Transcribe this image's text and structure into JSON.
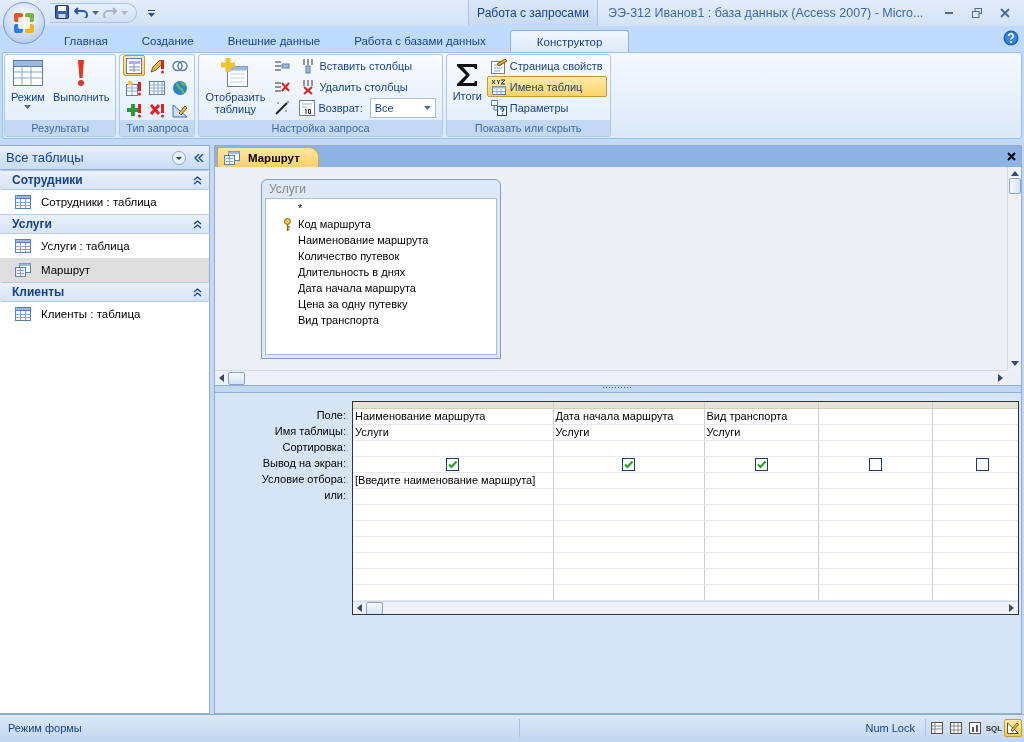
{
  "title_bar": {
    "contextual_tab": "Работа с запросами",
    "title": "ЭЭ-312 Иванов1 : база данных (Access 2007) - Micro..."
  },
  "ribbon_tabs": [
    {
      "label": "Главная",
      "selected": false
    },
    {
      "label": "Создание",
      "selected": false
    },
    {
      "label": "Внешние данные",
      "selected": false
    },
    {
      "label": "Работа с базами данных",
      "selected": false
    },
    {
      "label": "Конструктор",
      "selected": true
    }
  ],
  "ribbon": {
    "results": {
      "title": "Результаты",
      "buttons": [
        "Режим",
        "Выполнить"
      ]
    },
    "query_type": {
      "title": "Тип запроса",
      "buttons": [
        {
          "selected": true
        },
        {
          "selected": false
        },
        {
          "selected": false
        },
        {
          "selected": false
        },
        {
          "selected": false
        },
        {
          "selected": false
        },
        {
          "selected": false
        },
        {
          "selected": false
        },
        {
          "selected": false
        }
      ]
    },
    "query_setup": {
      "title": "Настройка запроса",
      "show_table": "Отобразить таблицу",
      "insert_columns": "Вставить столбцы",
      "delete_columns": "Удалить столбцы",
      "return_label": "Возврат:",
      "return_value": "Все"
    },
    "show_hide": {
      "title": "Показать или скрыть",
      "totals": "Итоги",
      "buttons": [
        {
          "label": "Страница свойств",
          "selected": false
        },
        {
          "label": "Имена таблиц",
          "selected": true
        },
        {
          "label": "Параметры",
          "selected": false
        }
      ]
    }
  },
  "navigation": {
    "header": "Все таблицы",
    "groups": [
      {
        "title": "Сотрудники",
        "items": [
          {
            "label": "Сотрудники : таблица",
            "kind": "table",
            "selected": false
          }
        ]
      },
      {
        "title": "Услуги",
        "items": [
          {
            "label": "Услуги : таблица",
            "kind": "table",
            "selected": false
          },
          {
            "label": "Маршрут",
            "kind": "query",
            "selected": true
          }
        ]
      },
      {
        "title": "Клиенты",
        "items": [
          {
            "label": "Клиенты : таблица",
            "kind": "table",
            "selected": false
          }
        ]
      }
    ]
  },
  "document_tab": {
    "label": "Маршрут"
  },
  "field_list": {
    "title": "Услуги",
    "fields": [
      {
        "name": "*",
        "primary_key": false
      },
      {
        "name": "Код маршрута",
        "primary_key": true
      },
      {
        "name": "Наименование маршрута",
        "primary_key": false
      },
      {
        "name": "Количество путевок",
        "primary_key": false
      },
      {
        "name": "Длительность в днях",
        "primary_key": false
      },
      {
        "name": "Дата начала маршрута",
        "primary_key": false
      },
      {
        "name": "Цена за одну путевку",
        "primary_key": false
      },
      {
        "name": "Вид транспорта",
        "primary_key": false
      }
    ]
  },
  "design_grid": {
    "row_labels": [
      "Поле:",
      "Имя таблицы:",
      "Сортировка:",
      "Вывод на экран:",
      "Условие отбора:",
      "или:"
    ],
    "columns": [
      {
        "field": "Наименование маршрута",
        "table": "Услуги",
        "show": true,
        "criteria": "[Введите наименование маршрута]"
      },
      {
        "field": "Дата начала маршрута",
        "table": "Услуги",
        "show": true
      },
      {
        "field": "Вид транспорта",
        "table": "Услуги",
        "show": true
      },
      {
        "show": false
      },
      {
        "show": false
      }
    ]
  },
  "status_bar": {
    "mode": "Режим формы",
    "num_lock": "Num Lock",
    "view_buttons": [
      {
        "selected": false
      },
      {
        "selected": false
      },
      {
        "selected": false
      },
      {
        "label": "SQL",
        "selected": false
      },
      {
        "selected": true
      }
    ]
  }
}
